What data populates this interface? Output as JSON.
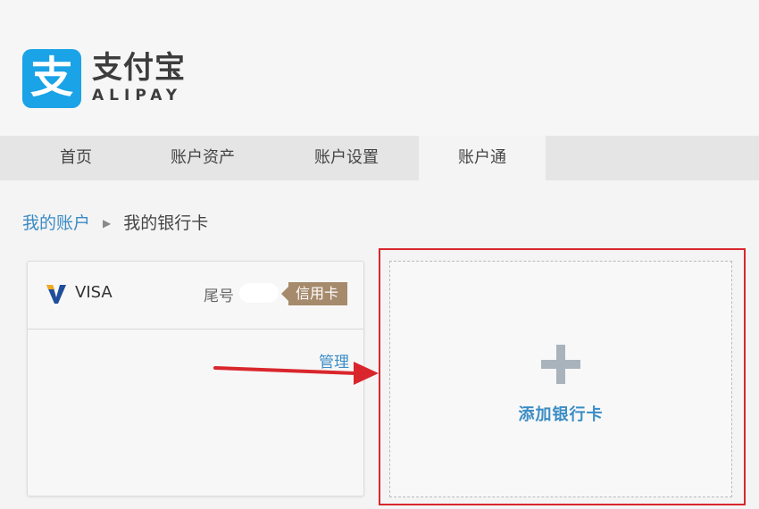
{
  "brand": {
    "icon_char": "支",
    "name_cn": "支付宝",
    "name_en": "ALIPAY",
    "color": "#1aa3e6"
  },
  "nav": {
    "items": [
      {
        "label": "首页"
      },
      {
        "label": "账户资产"
      },
      {
        "label": "账户设置"
      },
      {
        "label": "账户通",
        "active": true
      }
    ]
  },
  "breadcrumb": {
    "parent": "我的账户",
    "separator": "▶",
    "current": "我的银行卡"
  },
  "bank_card": {
    "network": "VISA",
    "tail_label": "尾号",
    "tail_number": "",
    "type_tag": "信用卡",
    "manage_label": "管理"
  },
  "add_card": {
    "icon": "plus-icon",
    "label": "添加银行卡"
  },
  "colors": {
    "link": "#3a8cc5",
    "highlight": "#d9262d",
    "tag": "#a68a6c"
  }
}
